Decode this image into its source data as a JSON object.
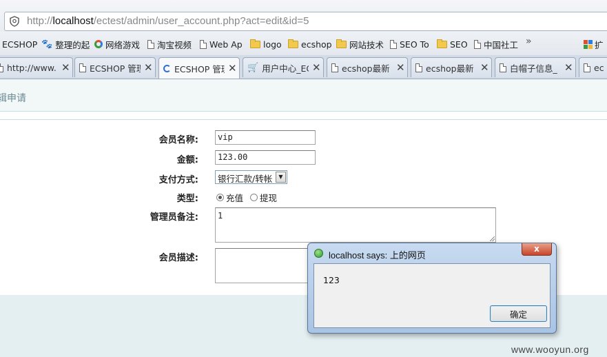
{
  "browser": {
    "url_prefix": "http://",
    "url_host": "localhost",
    "url_path": "/ectest/admin/user_account.php?act=edit&id=5",
    "bookmarks": [
      {
        "label": "ECSHOP",
        "icon": "none"
      },
      {
        "label": "整理的起",
        "icon": "paw-icon"
      },
      {
        "label": "网络游戏",
        "icon": "ring-icon"
      },
      {
        "label": "淘宝视频",
        "icon": "page-icon"
      },
      {
        "label": "Web Ap",
        "icon": "page-icon"
      },
      {
        "label": "logo",
        "icon": "folder-icon"
      },
      {
        "label": "ecshop",
        "icon": "folder-icon"
      },
      {
        "label": "网站技术",
        "icon": "folder-icon"
      },
      {
        "label": "SEO To",
        "icon": "page-icon"
      },
      {
        "label": "SEO",
        "icon": "folder-icon"
      },
      {
        "label": "中国社工",
        "icon": "page-icon"
      }
    ],
    "bookmarks_more": "»",
    "extensions_label": "扩",
    "tabs": [
      {
        "label": "http://www.",
        "icon": "page-icon",
        "active": false
      },
      {
        "label": "ECSHOP 管理",
        "icon": "page-icon",
        "active": false
      },
      {
        "label": "ECSHOP 管理",
        "icon": "spinner-icon",
        "active": true
      },
      {
        "label": "用户中心_EC",
        "icon": "cart-icon",
        "active": false
      },
      {
        "label": "ecshop最新",
        "icon": "page-icon",
        "active": false
      },
      {
        "label": "ecshop最新",
        "icon": "page-icon",
        "active": false
      },
      {
        "label": "白帽子信息_",
        "icon": "page-icon",
        "active": false
      },
      {
        "label": "ec",
        "icon": "page-icon",
        "active": false
      }
    ],
    "tab_close": "✕"
  },
  "page": {
    "title": "辑申请",
    "form": {
      "username_label": "会员名称:",
      "username_value": "vip",
      "amount_label": "金额:",
      "amount_value": "123.00",
      "payment_label": "支付方式:",
      "payment_value": "银行汇款/转帐",
      "type_label": "类型:",
      "type_options": [
        "充值",
        "提现"
      ],
      "type_selected": "充值",
      "admin_note_label": "管理员备注:",
      "admin_note_value": "1",
      "user_note_label": "会员描述:",
      "user_note_value": ""
    }
  },
  "dialog": {
    "title": "localhost says: 上的网页",
    "message": "123",
    "ok_label": "确定",
    "close_label": "x"
  },
  "watermark": "www.wooyun.org",
  "colors": {
    "accent": "#3c7fb1",
    "header_band": "#f2f7f8",
    "footer_band": "#e4eff2"
  }
}
